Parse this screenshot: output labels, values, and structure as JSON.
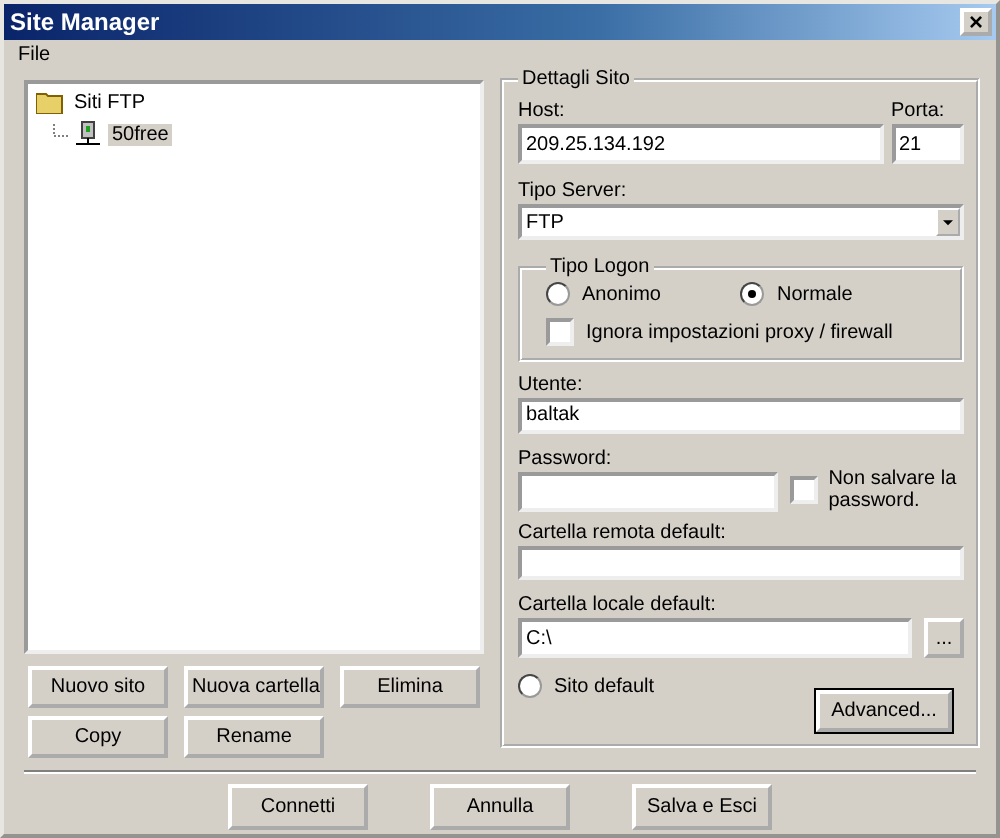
{
  "window": {
    "title": "Site Manager",
    "close": "×"
  },
  "menu": [
    {
      "label": "File"
    }
  ],
  "tree": [
    {
      "label": "Siti FTP",
      "kind": "folder",
      "selected": false,
      "children": [
        {
          "label": "50free",
          "kind": "server",
          "selected": true
        }
      ]
    }
  ],
  "site_buttons": [
    {
      "label": "Nuovo sito"
    },
    {
      "label": "Nuova cartella"
    },
    {
      "label": "Elimina"
    },
    {
      "label": "Copy"
    },
    {
      "label": "Rename"
    }
  ],
  "details": {
    "title": "Dettagli Sito",
    "host": {
      "label": "Host:",
      "value": "209.25.134.192"
    },
    "port": {
      "label": "Porta:",
      "value": "21"
    },
    "server_type": {
      "label": "Tipo Server:",
      "value": "FTP"
    },
    "logon": {
      "title": "Tipo Logon",
      "options": [
        {
          "label": "Anonimo",
          "selected": false
        },
        {
          "label": "Normale",
          "selected": true
        }
      ],
      "proxy": {
        "label": "Ignora impostazioni proxy / firewall",
        "checked": false
      }
    },
    "user": {
      "label": "Utente:",
      "value": "baltak"
    },
    "password": {
      "label": "Password:"
    },
    "dont_save": {
      "label": "Non salvare la password.",
      "checked": false
    },
    "remote_folder": {
      "label": "Cartella remota default:"
    },
    "local_folder": {
      "label": "Cartella locale default:",
      "value": "C:\\",
      "browse": "..."
    },
    "default_site": {
      "label": "Sito default",
      "selected": false
    },
    "advanced": {
      "label": "Advanced..."
    }
  },
  "footer_buttons": [
    {
      "label": "Connetti"
    },
    {
      "label": "Annulla"
    },
    {
      "label": "Salva e Esci"
    }
  ]
}
